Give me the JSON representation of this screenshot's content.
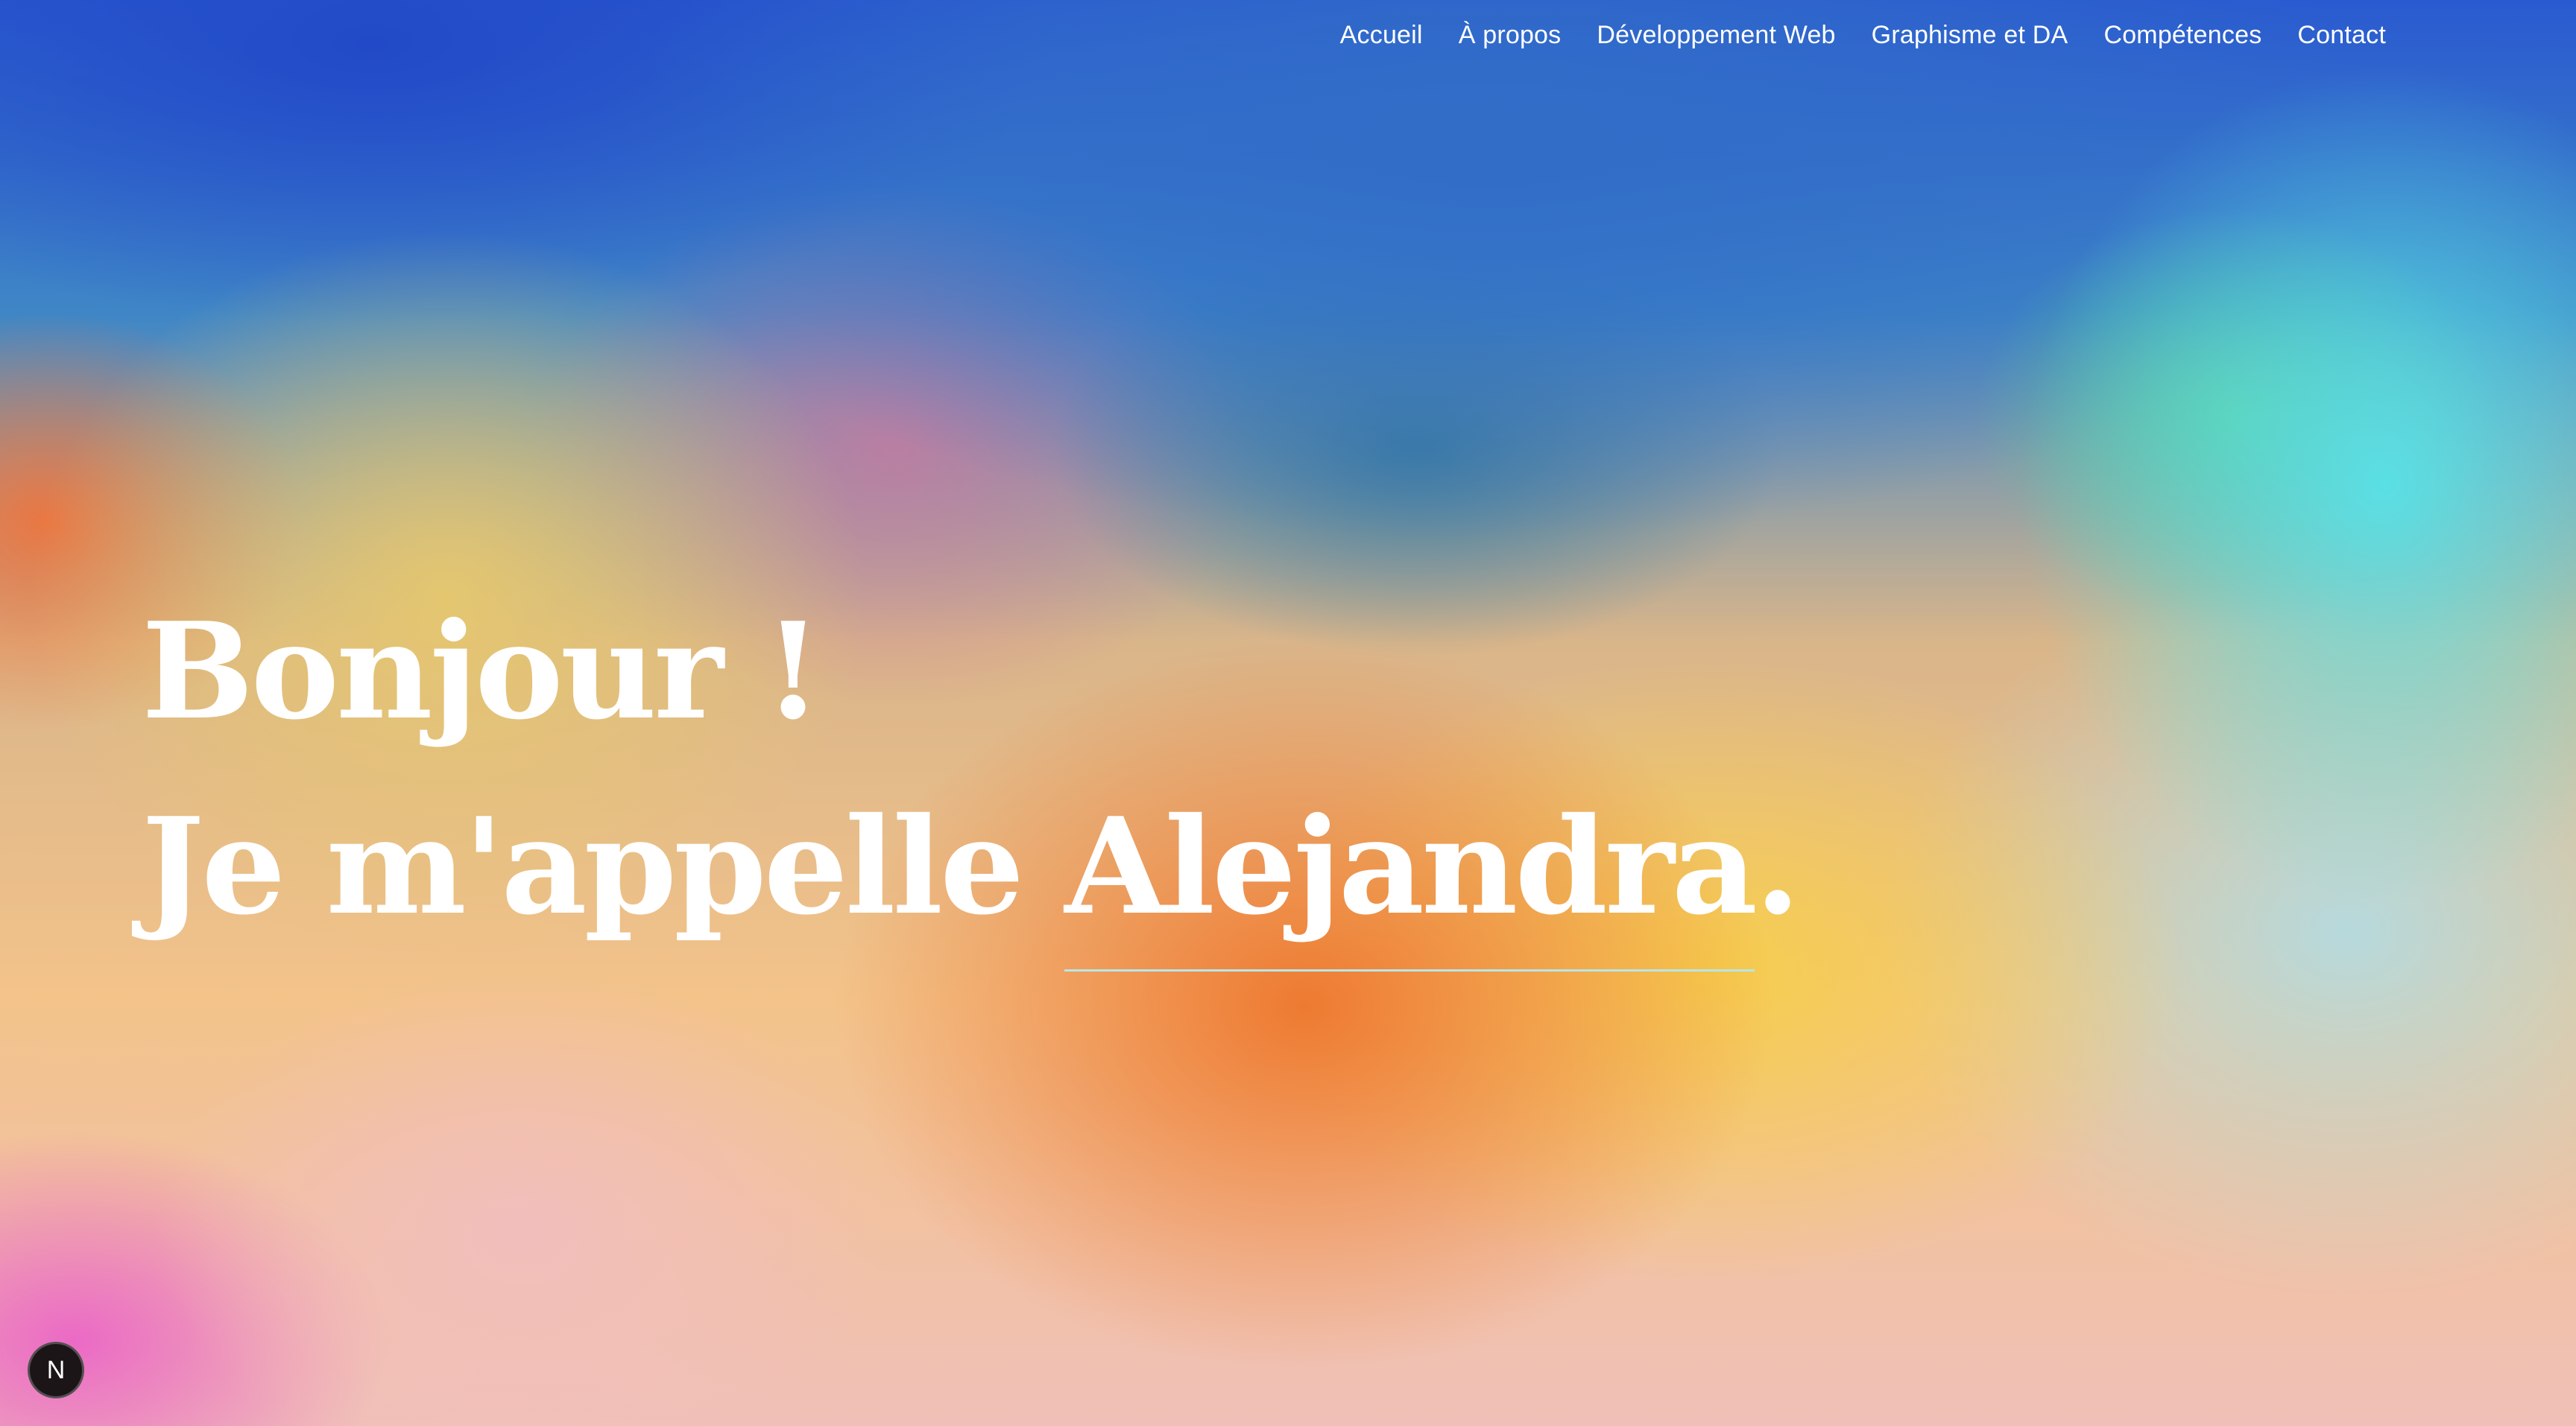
{
  "nav": {
    "items": [
      {
        "label": "Accueil"
      },
      {
        "label": "À propos"
      },
      {
        "label": "Développement Web"
      },
      {
        "label": "Graphisme et DA"
      },
      {
        "label": "Compétences"
      },
      {
        "label": "Contact"
      }
    ]
  },
  "hero": {
    "line1": "Bonjour !",
    "line2_prefix": "Je m'appelle ",
    "name": "Alejandra",
    "name_suffix": "."
  },
  "badge": {
    "letter": "N",
    "icon": "nextjs-icon"
  },
  "colors": {
    "text": "#ffffff",
    "underline": "#b8e6e8",
    "badge_bg": "#1b1518"
  }
}
